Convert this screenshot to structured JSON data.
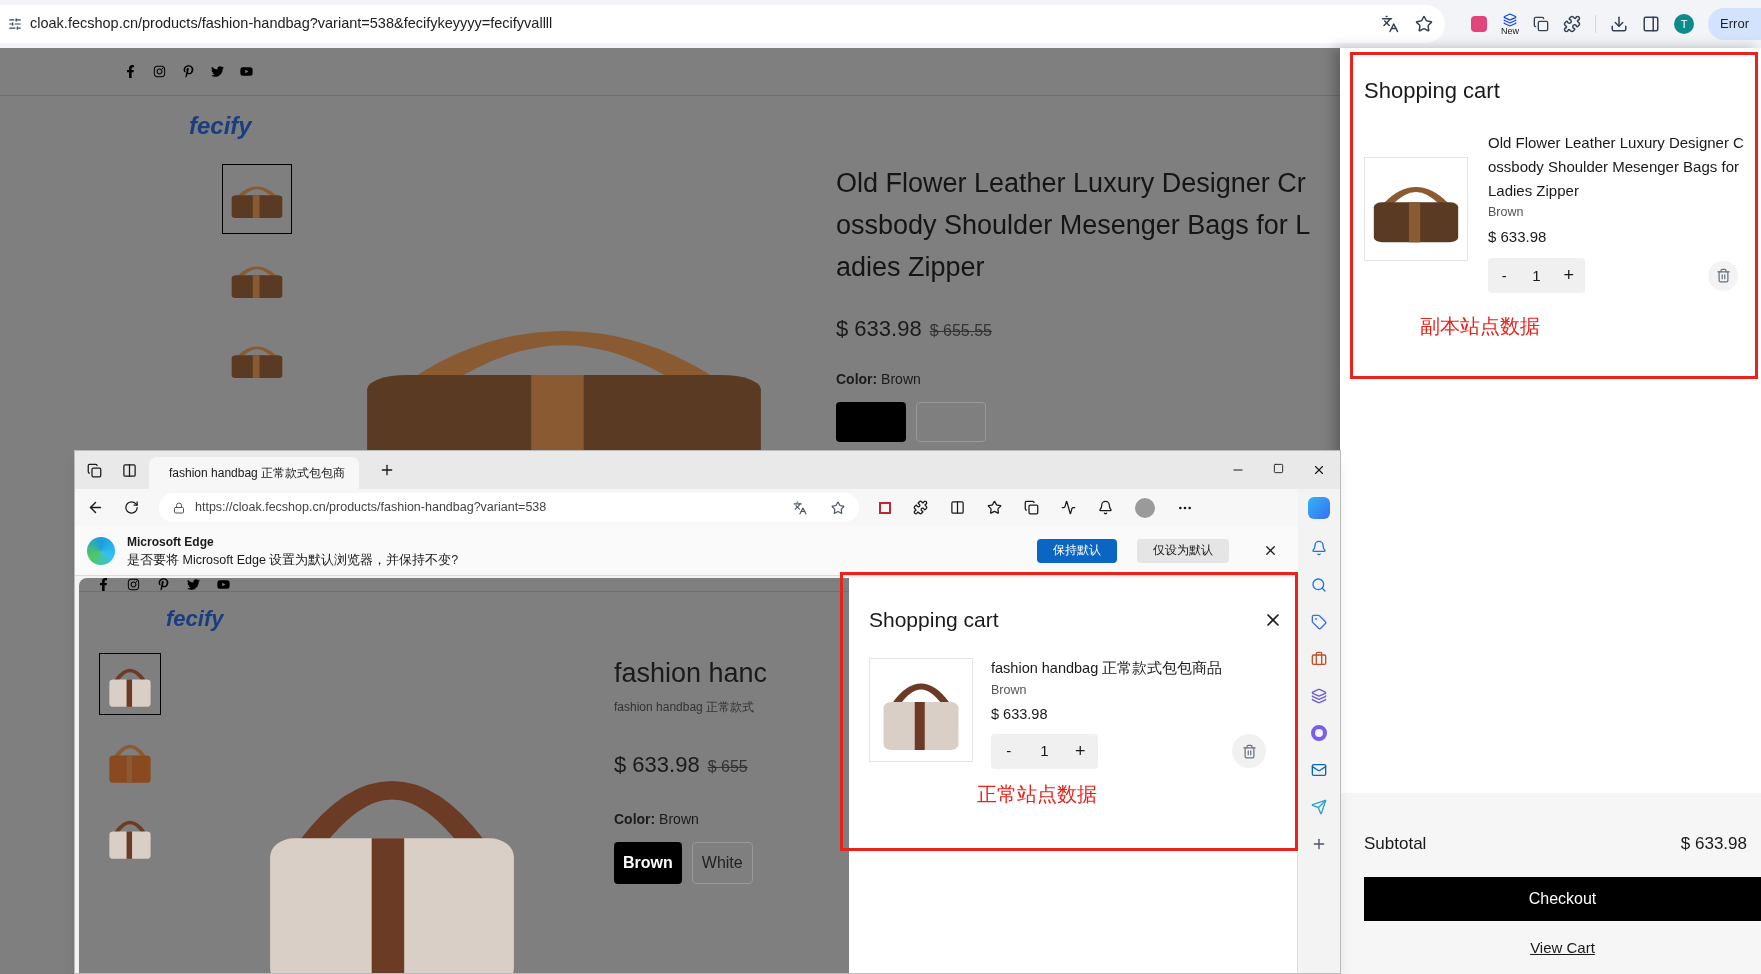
{
  "chrome": {
    "url": "cloak.fecshop.cn/products/fashion-handbag?variant=538&fecifykeyyyy=fecifyvallll",
    "extension_label": "New",
    "avatar": "T",
    "error_button": "Error"
  },
  "page": {
    "logo": "fecify",
    "thumbnails": [
      {
        "selected": true
      },
      {
        "selected": false
      },
      {
        "selected": false
      }
    ],
    "title_lines": [
      "Old Flower Leather Luxury Designer Cr",
      "ossbody Shoulder Mesenger Bags for L",
      "adies Zipper"
    ],
    "price": "$ 633.98",
    "old_price": "$ 655.55",
    "color_label": "Color:",
    "color_value": "Brown",
    "swatches": [
      {
        "selected": true
      },
      {
        "selected": false
      }
    ]
  },
  "cart": {
    "title": "Shopping cart",
    "item": {
      "name_lines": [
        "Old Flower Leather Luxury Designer C",
        "ossbody Shoulder Mesenger Bags for",
        "Ladies Zipper"
      ],
      "variant": "Brown",
      "price": "$ 633.98",
      "minus": "-",
      "qty": "1",
      "plus": "+"
    },
    "annotation": "副本站点数据",
    "subtotal_label": "Subtotal",
    "subtotal": "$ 633.98",
    "checkout": "Checkout",
    "view_cart": "View Cart"
  },
  "edge": {
    "tab_title": "fashion handbag 正常款式包包商",
    "url": "https://cloak.fecshop.cn/products/fashion-handbag?variant=538",
    "prompt": {
      "title": "Microsoft Edge",
      "message": "是否要将 Microsoft Edge 设置为默认浏览器，并保持不变?",
      "primary": "保持默认",
      "secondary": "仅设为默认"
    },
    "page": {
      "logo": "fecify",
      "thumbnails": [
        {
          "selected": true
        },
        {
          "selected": false
        },
        {
          "selected": false
        }
      ],
      "title": "fashion hanc",
      "subtitle": "fashion handbag 正常款式",
      "price": "$ 633.98",
      "old_price": "$ 655",
      "color_label": "Color:",
      "color_value": "Brown",
      "swatches": [
        {
          "label": "Brown",
          "selected": true
        },
        {
          "label": "White",
          "selected": false
        }
      ]
    },
    "cart": {
      "title": "Shopping cart",
      "item": {
        "name": "fashion handbag 正常款式包包商品",
        "variant": "Brown",
        "price": "$ 633.98",
        "minus": "-",
        "qty": "1",
        "plus": "+"
      },
      "annotation": "正常站点数据"
    }
  }
}
